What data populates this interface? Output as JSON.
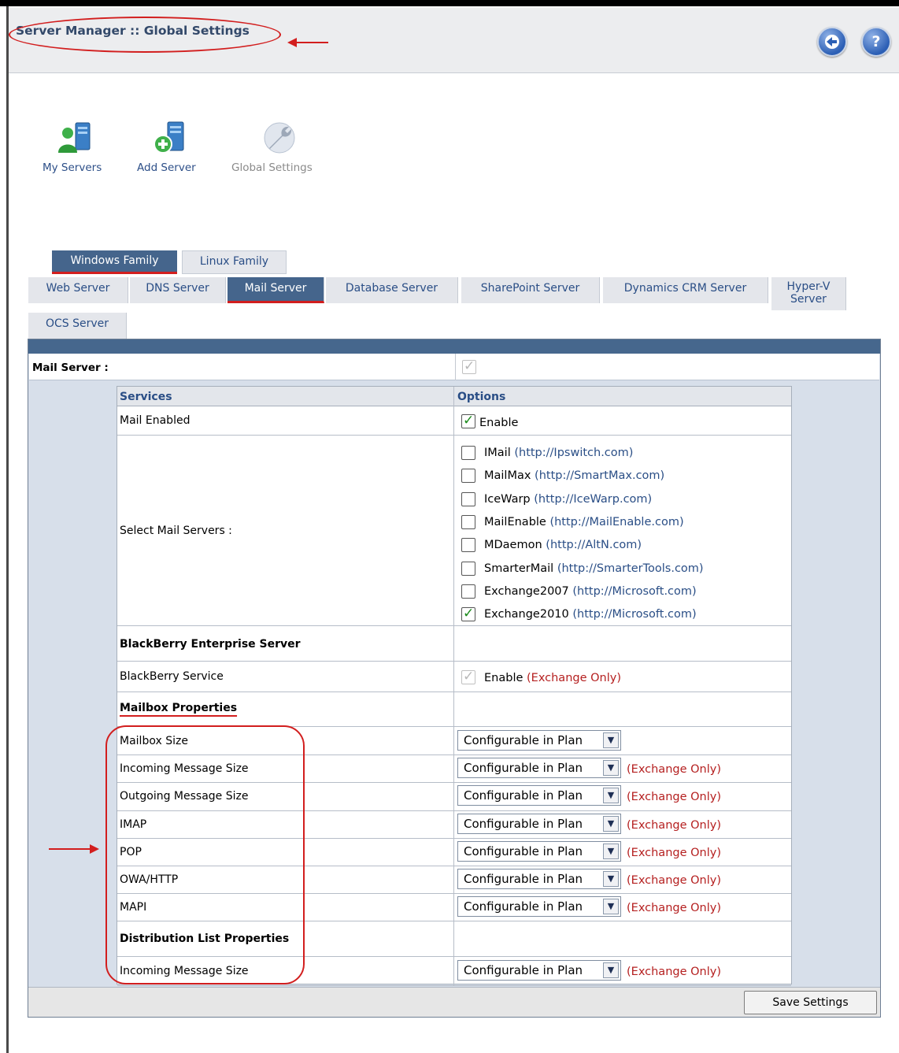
{
  "header": {
    "title": "Server Manager :: Global Settings",
    "back_button": "arrow-left-icon",
    "help_button": "?"
  },
  "toolbar": [
    {
      "label": "My Servers",
      "icon": "servers-user-icon"
    },
    {
      "label": "Add Server",
      "icon": "server-add-icon"
    },
    {
      "label": "Global Settings",
      "icon": "settings-wrench-icon"
    }
  ],
  "family_tabs": [
    "Windows Family",
    "Linux Family"
  ],
  "server_tabs": [
    "Web Server",
    "DNS Server",
    "Mail Server",
    "Database Server",
    "SharePoint Server",
    "Dynamics CRM Server",
    "Hyper-V Server",
    "OCS Server"
  ],
  "active_server_tab": "Mail Server",
  "mail_server": {
    "label": "Mail Server :",
    "columns": {
      "services": "Services",
      "options": "Options"
    },
    "mail_enabled": {
      "label": "Mail Enabled",
      "option": "Enable",
      "checked": true
    },
    "select_mail_servers": {
      "label": "Select Mail Servers :",
      "servers": [
        {
          "name": "IMail",
          "url": "(http://Ipswitch.com)",
          "checked": false
        },
        {
          "name": "MailMax",
          "url": "(http://SmartMax.com)",
          "checked": false
        },
        {
          "name": "IceWarp",
          "url": "(http://IceWarp.com)",
          "checked": false
        },
        {
          "name": "MailEnable",
          "url": "(http://MailEnable.com)",
          "checked": false
        },
        {
          "name": "MDaemon",
          "url": "(http://AltN.com)",
          "checked": false
        },
        {
          "name": "SmarterMail",
          "url": "(http://SmarterTools.com)",
          "checked": false
        },
        {
          "name": "Exchange2007",
          "url": "(http://Microsoft.com)",
          "checked": false
        },
        {
          "name": "Exchange2010",
          "url": "(http://Microsoft.com)",
          "checked": true
        }
      ]
    },
    "blackberry": {
      "section": "BlackBerry Enterprise Server",
      "service_label": "BlackBerry Service",
      "option": "Enable",
      "note": "(Exchange Only)"
    },
    "mailbox_properties": {
      "section": "Mailbox Properties",
      "rows": [
        {
          "label": "Mailbox Size",
          "value": "Configurable in Plan",
          "note": ""
        },
        {
          "label": "Incoming Message Size",
          "value": "Configurable in Plan",
          "note": "(Exchange Only)"
        },
        {
          "label": "Outgoing Message Size",
          "value": "Configurable in Plan",
          "note": "(Exchange Only)"
        },
        {
          "label": "IMAP",
          "value": "Configurable in Plan",
          "note": "(Exchange Only)"
        },
        {
          "label": "POP",
          "value": "Configurable in Plan",
          "note": "(Exchange Only)"
        },
        {
          "label": "OWA/HTTP",
          "value": "Configurable in Plan",
          "note": "(Exchange Only)"
        },
        {
          "label": "MAPI",
          "value": "Configurable in Plan",
          "note": "(Exchange Only)"
        }
      ]
    },
    "distribution_list": {
      "section": "Distribution List Properties",
      "rows": [
        {
          "label": "Incoming Message Size",
          "value": "Configurable in Plan",
          "note": "(Exchange Only)"
        }
      ]
    }
  },
  "save_button": "Save Settings",
  "colors": {
    "accent": "#45658c",
    "annotation": "#d21e1e",
    "link": "#2a4e86"
  }
}
